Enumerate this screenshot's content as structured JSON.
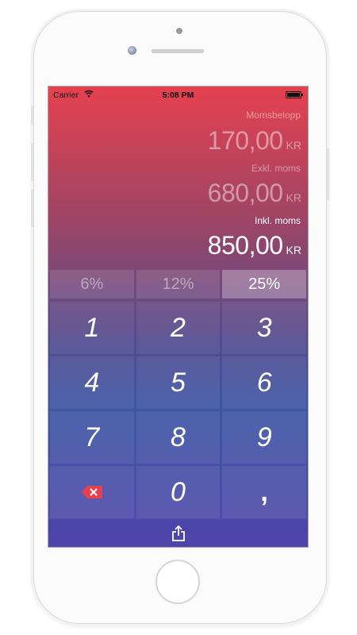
{
  "statusbar": {
    "carrier": "Carrier",
    "time": "5:08 PM"
  },
  "amounts": {
    "vat": {
      "label": "Momsbelopp",
      "value": "170,00",
      "currency": "KR"
    },
    "excl": {
      "label": "Exkl. moms",
      "value": "680,00",
      "currency": "KR"
    },
    "incl": {
      "label": "Inkl. moms",
      "value": "850,00",
      "currency": "KR"
    }
  },
  "rates": [
    {
      "label": "6%",
      "selected": false
    },
    {
      "label": "12%",
      "selected": false
    },
    {
      "label": "25%",
      "selected": true
    }
  ],
  "keypad": {
    "keys": [
      "1",
      "2",
      "3",
      "4",
      "5",
      "6",
      "7",
      "8",
      "9",
      "",
      "0",
      ","
    ],
    "delete_icon": "backspace-icon"
  },
  "toolbar": {
    "share_icon": "share-icon"
  },
  "colors": {
    "gradient_top": "#e5414f",
    "gradient_bottom": "#5449ab",
    "delete_icon": "#e5414f"
  }
}
